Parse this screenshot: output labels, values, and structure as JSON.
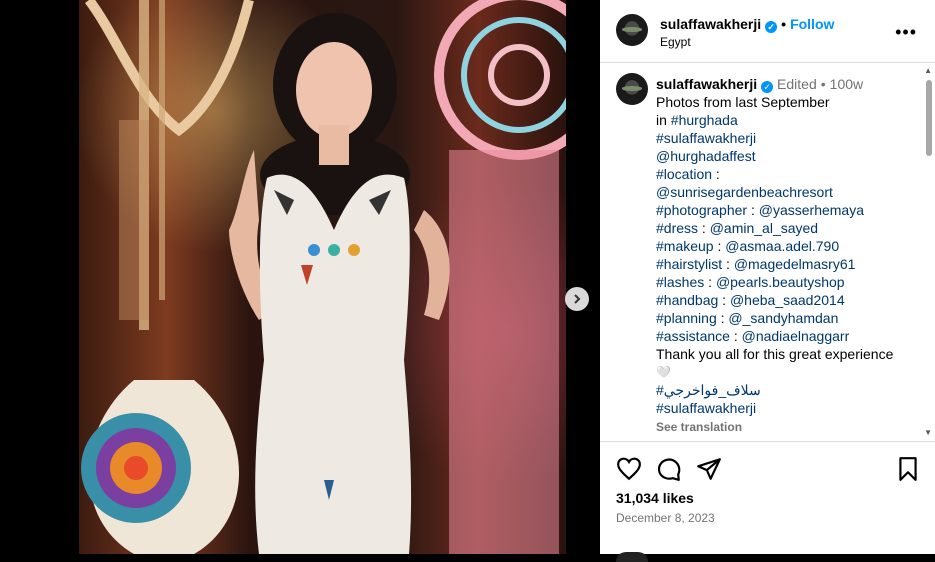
{
  "post": {
    "username": "sulaffawakherji",
    "follow_label": "Follow",
    "location": "Egypt",
    "more_label": "•••"
  },
  "caption": {
    "username": "sulaffawakherji",
    "edited": "Edited",
    "time": "100w",
    "line1": "Photos from last September",
    "in_word": "in ",
    "hashtag_hurghada": "#hurghada",
    "tag2": "#sulaffawakherji",
    "tag3": "@hurghadaffest",
    "tag4": "#location",
    "tag4_sep": " :",
    "tag5": "@sunrisegardenbeachresort",
    "rows": [
      {
        "k": "#photographer",
        "v": "@yasserhemaya"
      },
      {
        "k": "#dress",
        "v": "@amin_al_sayed"
      },
      {
        "k": "#makeup",
        "v": "@asmaa.adel.790"
      },
      {
        "k": "#hairstylist",
        "v": "@magedelmasry61"
      },
      {
        "k": "#lashes",
        "v": "@pearls.beautyshop"
      },
      {
        "k": "#handbag",
        "v": "@heba_saad2014"
      },
      {
        "k": "#planning",
        "v": "@_sandyhamdan"
      },
      {
        "k": "#assistance",
        "v": "@nadiaelnaggarr"
      }
    ],
    "thanks": "Thank you all for this great experience",
    "heart": "🤍",
    "arabic_tag": "#سلاف_فواخرجي",
    "last_tag": "#sulaffawakherji",
    "see_translation": "See translation"
  },
  "engagement": {
    "likes": "31,034 likes",
    "date": "December 8, 2023"
  },
  "colors": {
    "link": "#00376b",
    "follow": "#0095f6",
    "muted": "#737373"
  }
}
